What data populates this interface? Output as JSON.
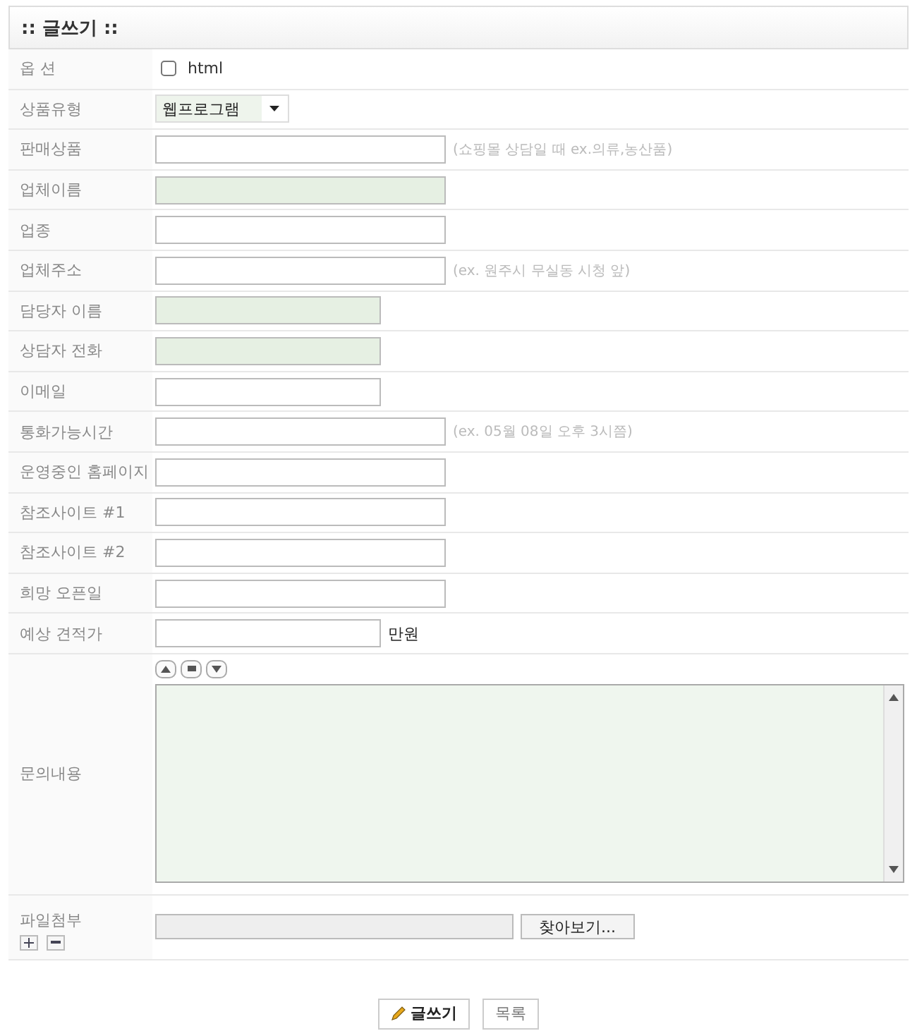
{
  "header": {
    "title": ":: 글쓰기 ::"
  },
  "rows": [
    {
      "label": "옵 션",
      "kind": "checkbox",
      "option": "html",
      "checked": false
    },
    {
      "label": "상품유형",
      "kind": "select",
      "value": "웹프로그램"
    },
    {
      "label": "판매상품",
      "kind": "text",
      "highlighted": false,
      "hint": "(쇼핑몰 상담일 때 ex.의류,농산품)"
    },
    {
      "label": "업체이름",
      "kind": "text",
      "highlighted": true
    },
    {
      "label": "업종",
      "kind": "text",
      "highlighted": false
    },
    {
      "label": "업체주소",
      "kind": "text",
      "highlighted": false,
      "hint": "(ex. 원주시 무실동 시청 앞)"
    },
    {
      "label": "담당자 이름",
      "kind": "short-text",
      "highlighted": true
    },
    {
      "label": "상담자 전화",
      "kind": "short-text",
      "highlighted": true
    },
    {
      "label": "이메일",
      "kind": "short-text",
      "highlighted": false
    },
    {
      "label": "통화가능시간",
      "kind": "text",
      "highlighted": false,
      "hint": "(ex. 05월 08일 오후 3시쯤)"
    },
    {
      "label": "운영중인 홈페이지",
      "kind": "text",
      "highlighted": false
    },
    {
      "label": "참조사이트 #1",
      "kind": "text",
      "highlighted": false
    },
    {
      "label": "참조사이트 #2",
      "kind": "text",
      "highlighted": false
    },
    {
      "label": "희망 오픈일",
      "kind": "text",
      "highlighted": false
    },
    {
      "label": "예상 견적가",
      "kind": "short-text",
      "highlighted": false,
      "suffix": "만원"
    },
    {
      "label": "문의내용",
      "kind": "textarea",
      "highlighted": true
    },
    {
      "label": "파일첨부",
      "kind": "file",
      "browse": "찾아보기..."
    }
  ],
  "buttons": [
    {
      "label": "글쓰기",
      "kind": "write"
    },
    {
      "label": "목록",
      "kind": "list"
    }
  ]
}
